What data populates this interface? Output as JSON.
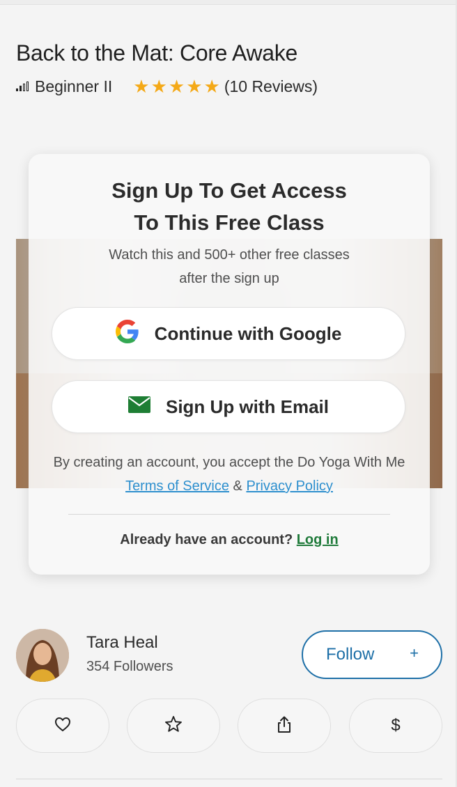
{
  "class": {
    "title": "Back to the Mat: Core Awake",
    "level": "Beginner II",
    "rating": 5,
    "reviews": "(10 Reviews)"
  },
  "modal": {
    "heading": "Sign Up To Get Access\nTo This Free Class",
    "subtext": "Watch this and 500+ other free classes\nafter the sign up",
    "google_label": "Continue with Google",
    "email_label": "Sign Up with Email",
    "legal_prefix": "By creating an account, you accept the Do Yoga With Me ",
    "terms": "Terms of Service",
    "amp": " & ",
    "privacy": "Privacy Policy",
    "login_prompt": "Already have an account? ",
    "login_link": "Log in"
  },
  "instructor": {
    "name": "Tara Heal",
    "followers": "354 Followers",
    "follow_label": "Follow",
    "follow_plus": "+"
  },
  "actions": {
    "favorite_icon": "heart-icon",
    "bookmark_icon": "star-icon",
    "share_icon": "share-icon",
    "donate_symbol": "$"
  },
  "colors": {
    "star": "#f4a917",
    "link": "#2d8fce",
    "login": "#1f7a3a",
    "follow": "#1d6fa7"
  }
}
